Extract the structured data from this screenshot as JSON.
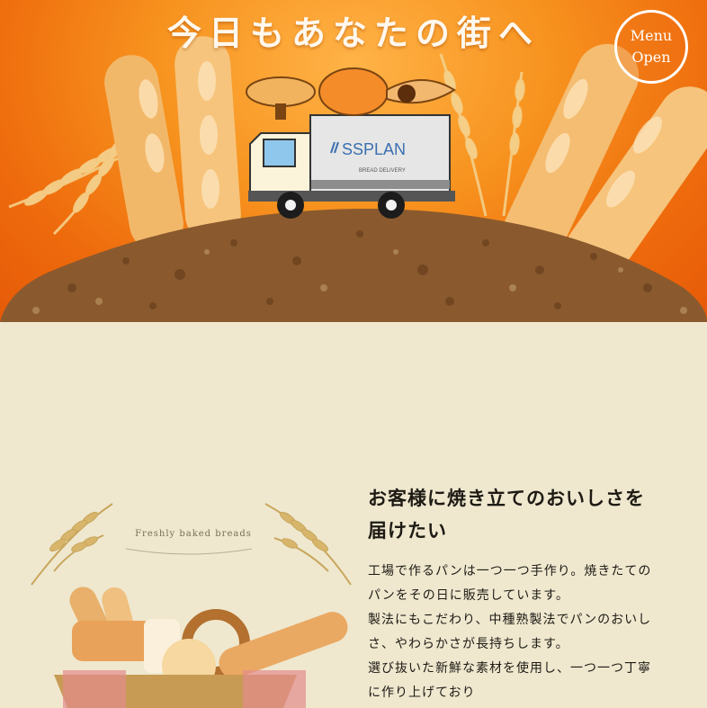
{
  "hero": {
    "title": "今日もあなたの街へ",
    "truck_brand": "SSPLAN",
    "truck_sub": "BREAD DELIVERY"
  },
  "menu": {
    "line1": "Menu",
    "line2": "Open"
  },
  "section": {
    "heading_line1": "お客様に焼き立てのおいしさを",
    "heading_line2": "届けたい",
    "paragraph_lines": [
      "工場で作るパンは一つ一つ手作り。焼きたての",
      "パンをその日に販売しています。",
      "製法にもこだわり、中種熟製法でパンのおいし",
      "さ、やわらかさが長持ちします。",
      "選び抜いた新鮮な素材を使用し、一つ一つ丁寧",
      "に作り上げており"
    ],
    "illustration_caption": "Freshly baked breads"
  },
  "colors": {
    "hero_orange": "#f7921e",
    "ground_brown": "#8a5a2e",
    "page_bg": "#efe8cf",
    "text": "#1e1a14"
  }
}
